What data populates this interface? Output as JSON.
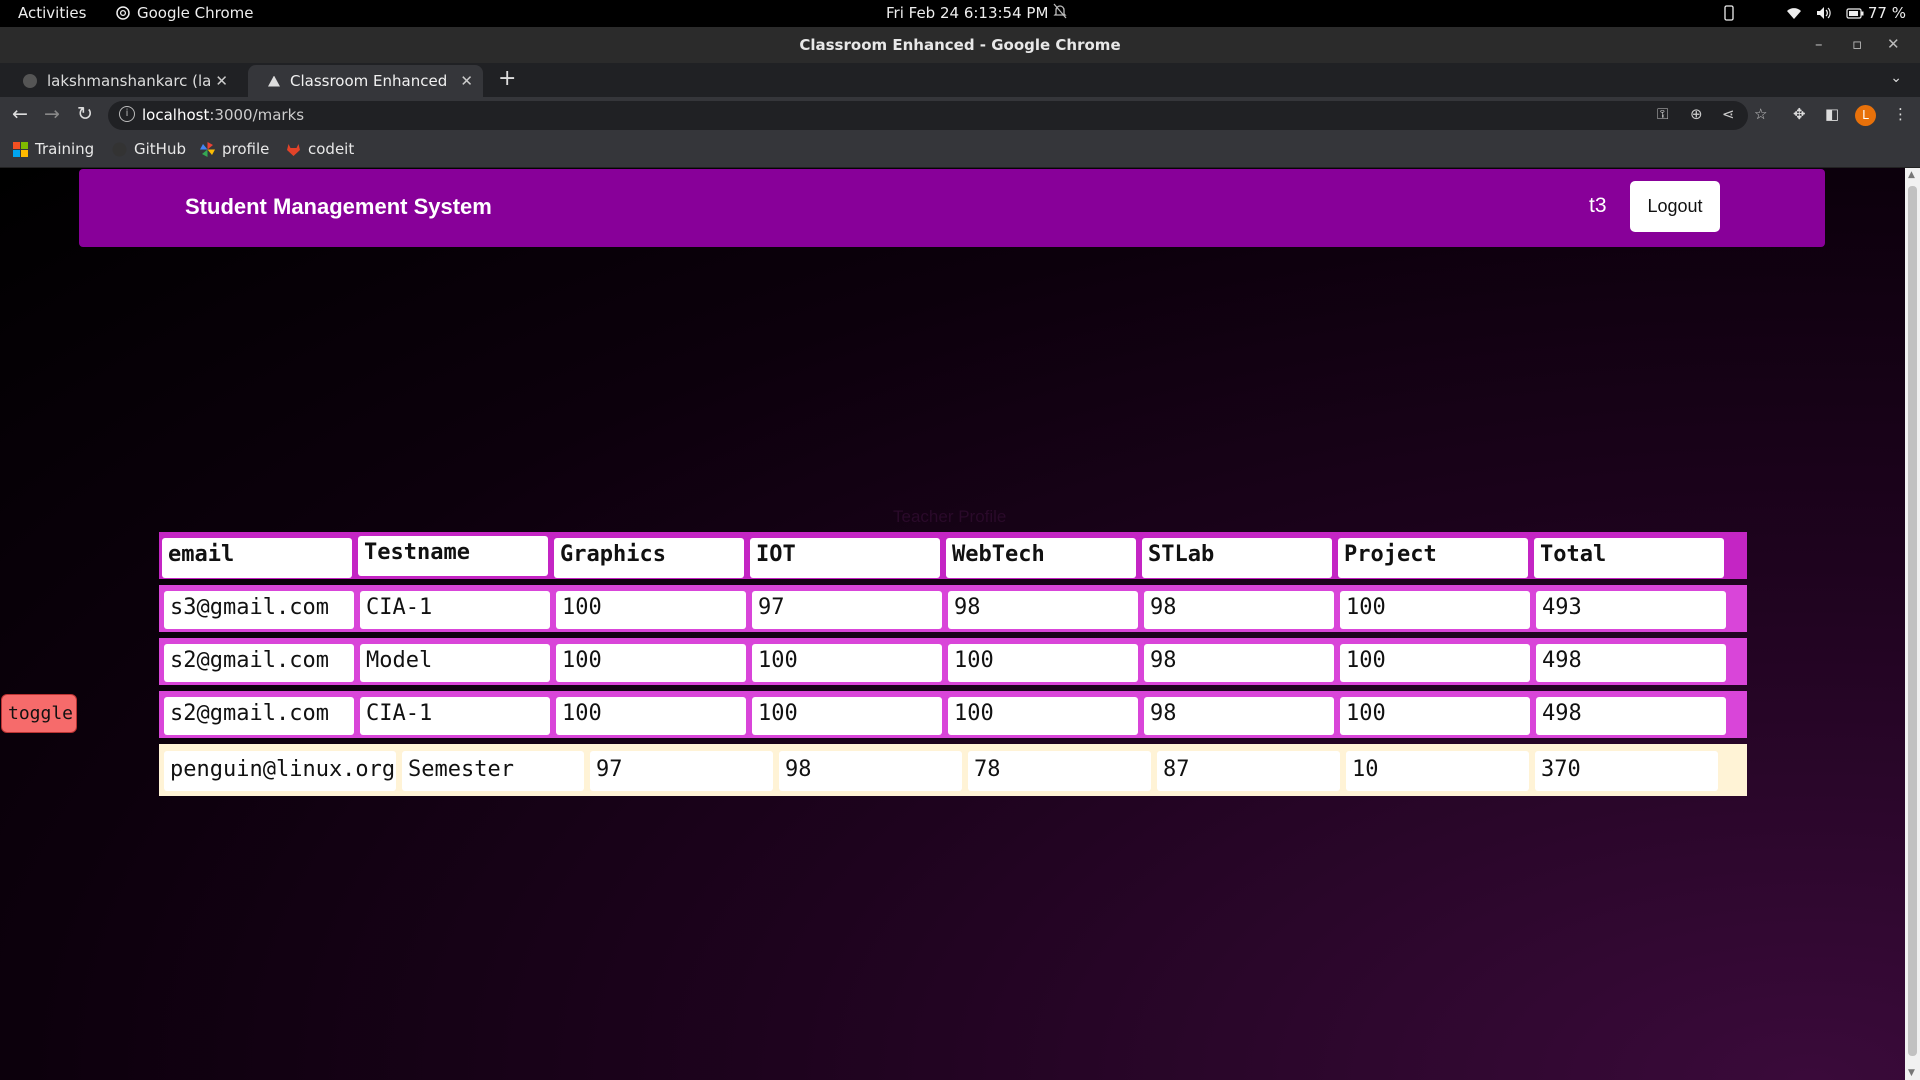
{
  "os_bar": {
    "activities": "Activities",
    "app_name": "Google Chrome",
    "clock": "Fri Feb 24   6:13:54 PM",
    "battery": "77 %"
  },
  "window": {
    "title": "Classroom Enhanced - Google Chrome"
  },
  "tabs": [
    {
      "label": "lakshmanshankarc (lakshm",
      "active": false
    },
    {
      "label": "Classroom Enhanced",
      "active": true
    }
  ],
  "address_bar": {
    "host": "localhost",
    "path": ":3000/marks",
    "avatar_letter": "L"
  },
  "bookmarks": [
    {
      "label": "Training",
      "icon": "apps-grid-icon"
    },
    {
      "label": "GitHub",
      "icon": "github-icon"
    },
    {
      "label": "profile",
      "icon": "pinwheel-icon"
    },
    {
      "label": "codeit",
      "icon": "gitlab-icon"
    }
  ],
  "header": {
    "brand": "Student Management System",
    "user": "t3",
    "logout_label": "Logout"
  },
  "profile_label": "Teacher Profile",
  "toggle_label": "toggle",
  "marks_table": {
    "columns": [
      "email",
      "Testname",
      "Graphics",
      "IOT",
      "WebTech",
      "STLab",
      "Project",
      "Total"
    ],
    "rows": [
      [
        "s3@gmail.com",
        "CIA-1",
        "100",
        "97",
        "98",
        "98",
        "100",
        "493"
      ],
      [
        "s2@gmail.com",
        "Model",
        "100",
        "100",
        "100",
        "98",
        "100",
        "498"
      ],
      [
        "s2@gmail.com",
        "CIA-1",
        "100",
        "100",
        "100",
        "98",
        "100",
        "498"
      ]
    ],
    "extra_row": [
      "penguin@linux.org",
      "Semester",
      "97",
      "98",
      "78",
      "87",
      "10",
      "370"
    ]
  },
  "colors": {
    "header_bg": "#880099",
    "table_header_bg": "#c425c4",
    "table_row_bg": "#d945d9",
    "extra_row_bg": "#fff3d6",
    "toggle_bg": "#f66b6b"
  }
}
